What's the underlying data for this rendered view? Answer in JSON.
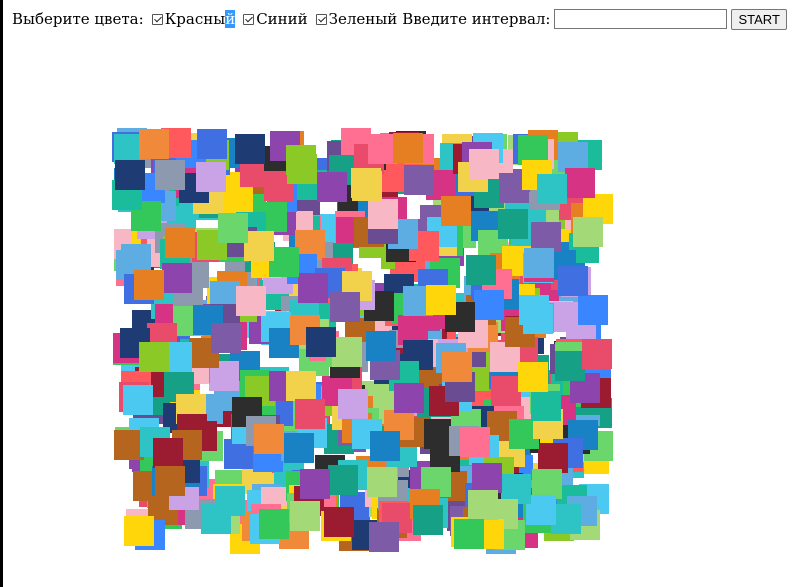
{
  "toolbar": {
    "colors_label": "Выберите цвета:",
    "red_part1": "Красны",
    "red_part2": "й",
    "blue_label": "Синий",
    "green_label": "Зеленый",
    "interval_label": "Введите интервал:",
    "interval_value": "",
    "start_label": "START"
  },
  "checkboxes": {
    "red_checked": true,
    "blue_checked": true,
    "green_checked": true
  },
  "canvas": {
    "square_count": 720,
    "palette": [
      "#e94b6b",
      "#3f6fe0",
      "#34c759",
      "#f2d24a",
      "#8e44ad",
      "#2ec4c6",
      "#f08a3a",
      "#d63384",
      "#6bd66b",
      "#1f3b73",
      "#b5651d",
      "#c9a3e6",
      "#1abc9c",
      "#9b1b30",
      "#5dade2",
      "#f7b7c5",
      "#2d2d2d",
      "#a3d977",
      "#e67e22",
      "#7d5ba6",
      "#16a085",
      "#ff6f91",
      "#3a86ff",
      "#ffd60a",
      "#4cc9f0",
      "#8d99ae",
      "#6a4c93",
      "#ff595e",
      "#8ac926",
      "#1982c4"
    ]
  }
}
